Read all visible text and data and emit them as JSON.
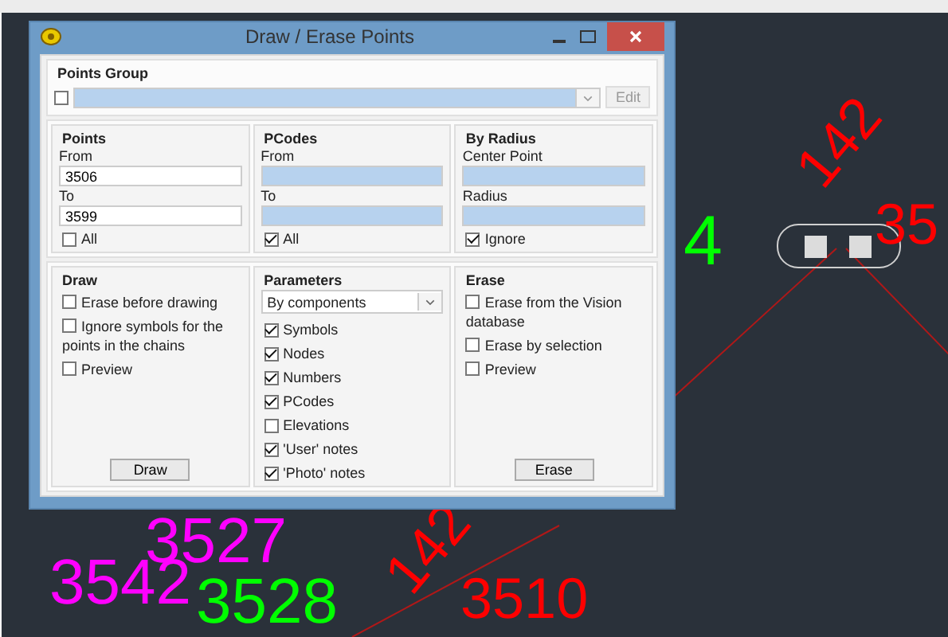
{
  "canvas_labels": [
    {
      "text": "4",
      "color": "#00ff00"
    },
    {
      "text": "142",
      "color": "#ff0000"
    },
    {
      "text": "35",
      "color": "#ff0000"
    },
    {
      "text": "3527",
      "color": "#ff00ff"
    },
    {
      "text": "3542",
      "color": "#ff00ff"
    },
    {
      "text": "3528",
      "color": "#00ff00"
    },
    {
      "text": "142",
      "color": "#ff0000"
    },
    {
      "text": "3510",
      "color": "#ff0000"
    }
  ],
  "window": {
    "title": "Draw / Erase Points"
  },
  "points_group": {
    "title": "Points Group",
    "checked": false,
    "edit_button": "Edit"
  },
  "points": {
    "title": "Points",
    "from_label": "From",
    "from_value": "3506",
    "to_label": "To",
    "to_value": "3599",
    "all": {
      "label": "All",
      "checked": false
    }
  },
  "pcodes": {
    "title": "PCodes",
    "from_label": "From",
    "to_label": "To",
    "all": {
      "label": "All",
      "checked": true
    }
  },
  "by_radius": {
    "title": "By Radius",
    "center_label": "Center Point",
    "radius_label": "Radius",
    "ignore": {
      "label": "Ignore",
      "checked": true
    }
  },
  "draw": {
    "title": "Draw",
    "options": [
      {
        "label": "Erase before drawing",
        "checked": false
      },
      {
        "label": "Ignore symbols for the points in the chains",
        "checked": false
      },
      {
        "label": "Preview",
        "checked": false
      }
    ],
    "button": "Draw"
  },
  "parameters": {
    "title": "Parameters",
    "mode": "By components",
    "options": [
      {
        "label": "Symbols",
        "checked": true
      },
      {
        "label": "Nodes",
        "checked": true
      },
      {
        "label": "Numbers",
        "checked": true
      },
      {
        "label": "PCodes",
        "checked": true
      },
      {
        "label": "Elevations",
        "checked": false
      },
      {
        "label": "'User' notes",
        "checked": true
      },
      {
        "label": "'Photo' notes",
        "checked": true
      }
    ]
  },
  "erase": {
    "title": "Erase",
    "options": [
      {
        "label": "Erase from the Vision database",
        "checked": false
      },
      {
        "label": "Erase by selection",
        "checked": false
      },
      {
        "label": "Preview",
        "checked": false
      }
    ],
    "button": "Erase"
  }
}
